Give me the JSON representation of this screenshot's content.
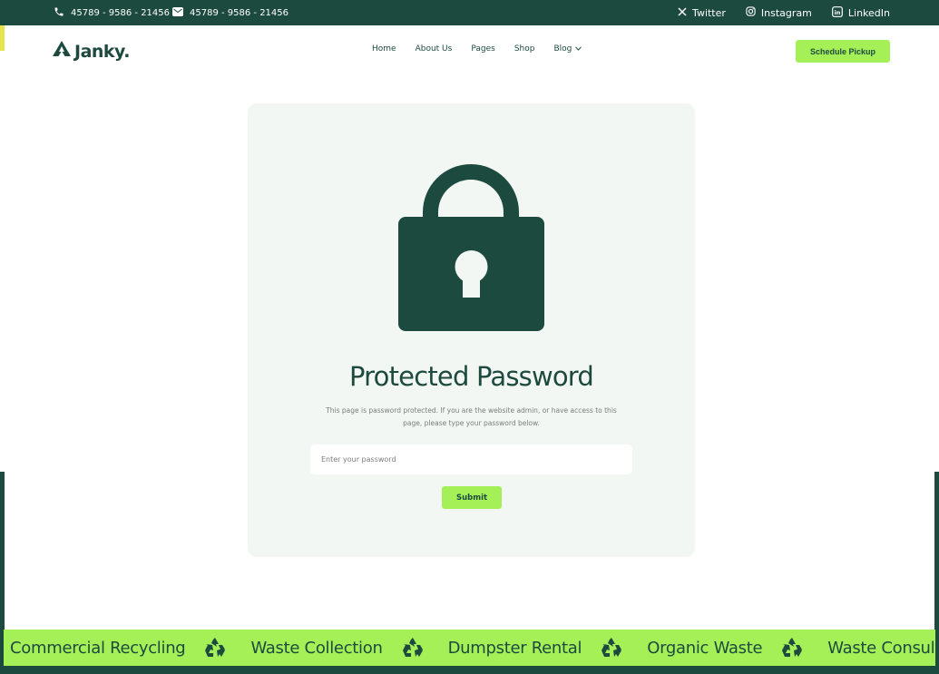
{
  "topbar": {
    "phone": "45789 - 9586 - 21456",
    "email": "45789 - 9586 - 21456",
    "social": [
      {
        "label": "Twitter",
        "icon": "x-icon"
      },
      {
        "label": "Instagram",
        "icon": "instagram-icon"
      },
      {
        "label": "LinkedIn",
        "icon": "linkedin-icon"
      }
    ]
  },
  "brand": {
    "name": "Janky.",
    "primary_color": "#1d4a3f",
    "accent_color": "#a6f057"
  },
  "nav": {
    "items": [
      {
        "label": "Home"
      },
      {
        "label": "About Us"
      },
      {
        "label": "Pages"
      },
      {
        "label": "Shop"
      },
      {
        "label": "Blog",
        "has_dropdown": true
      }
    ],
    "cta_label": "Schedule Pickup"
  },
  "protected": {
    "title": "Protected Password",
    "description_line1": "This page is password protected. If you are the website admin, or have access to this",
    "description_line2": "page, please type your password below.",
    "input_value": "",
    "input_placeholder": "Enter your password",
    "submit_label": "Submit",
    "icon": "lock-icon"
  },
  "marquee": {
    "icon": "recycle-icon",
    "items": [
      "Commercial Recycling",
      "Waste Collection",
      "Dumpster Rental",
      "Organic Waste",
      "Waste Consulting"
    ]
  }
}
